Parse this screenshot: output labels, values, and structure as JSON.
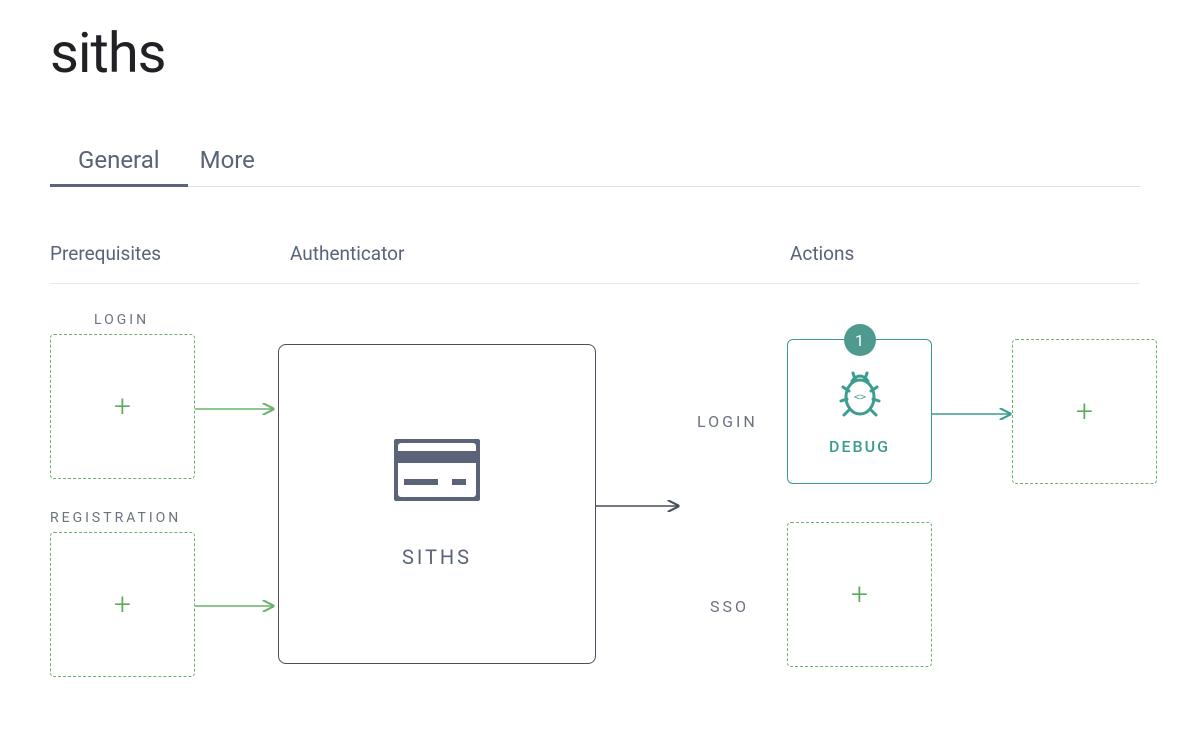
{
  "title": "siths",
  "tabs": {
    "general": "General",
    "more": "More"
  },
  "headers": {
    "prerequisites": "Prerequisites",
    "authenticator": "Authenticator",
    "actions": "Actions"
  },
  "prereq": {
    "login_label": "LOGIN",
    "registration_label": "REGISTRATION",
    "add_glyph": "+"
  },
  "authenticator": {
    "name": "SITHS"
  },
  "action_rows": {
    "login": "LOGIN",
    "sso": "SSO"
  },
  "actions": {
    "debug": {
      "label": "DEBUG",
      "badge": "1"
    },
    "add_glyph": "+"
  },
  "colors": {
    "accent_green": "#5cab5d",
    "accent_teal": "#3a9d8f",
    "text_muted": "#5a6378",
    "border_dark": "#4a4f5c"
  }
}
